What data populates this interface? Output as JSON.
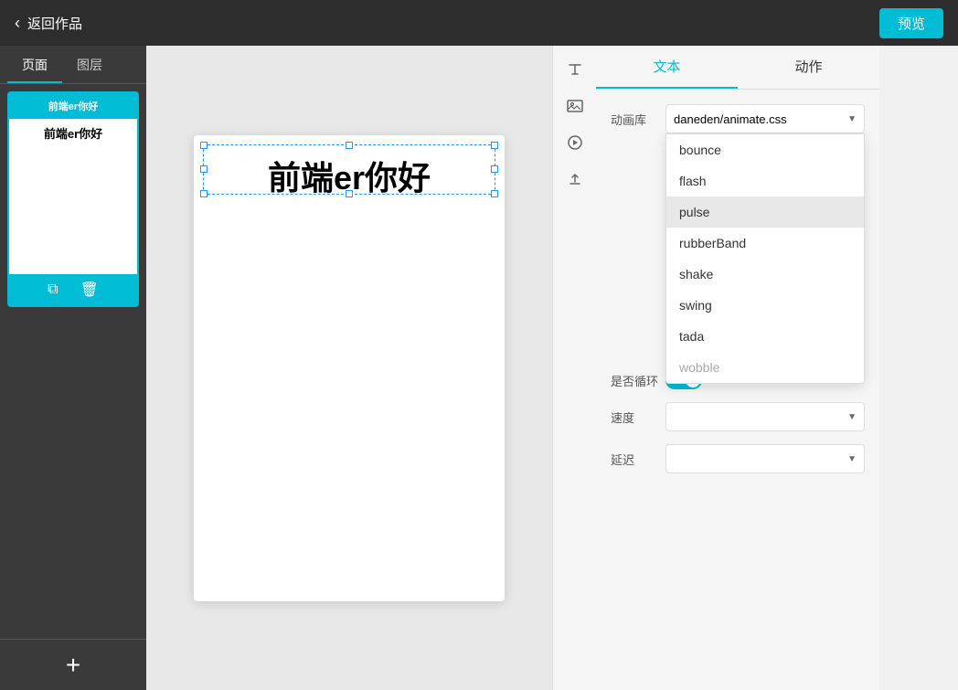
{
  "topbar": {
    "back_label": "返回作品",
    "preview_label": "预览"
  },
  "tabs": {
    "items": [
      {
        "label": "页面",
        "active": true
      },
      {
        "label": "图层",
        "active": false
      }
    ]
  },
  "canvas": {
    "text": "前端er你好"
  },
  "thumbnail": {
    "title": "前端er你好"
  },
  "panel": {
    "tabs": [
      {
        "label": "文本",
        "active": true
      },
      {
        "label": "动作",
        "active": false
      }
    ],
    "fields": {
      "library_label": "动画库",
      "library_value": "daneden/animate.css",
      "loop_label": "是否循环",
      "speed_label": "速度",
      "delay_label": "延迟"
    },
    "dropdown_items": [
      {
        "label": "bounce",
        "highlighted": false
      },
      {
        "label": "flash",
        "highlighted": false
      },
      {
        "label": "pulse",
        "highlighted": true
      },
      {
        "label": "rubberBand",
        "highlighted": false
      },
      {
        "label": "shake",
        "highlighted": false
      },
      {
        "label": "swing",
        "highlighted": false
      },
      {
        "label": "tada",
        "highlighted": false
      },
      {
        "label": "wobble",
        "highlighted": false
      }
    ]
  },
  "sidebar_bottom": {
    "add_label": "+"
  },
  "icons": {
    "back": "‹",
    "pencil": "✎",
    "image": "⊞",
    "play": "▶",
    "upload": "↑",
    "copy": "⧉",
    "delete": "🗑"
  }
}
